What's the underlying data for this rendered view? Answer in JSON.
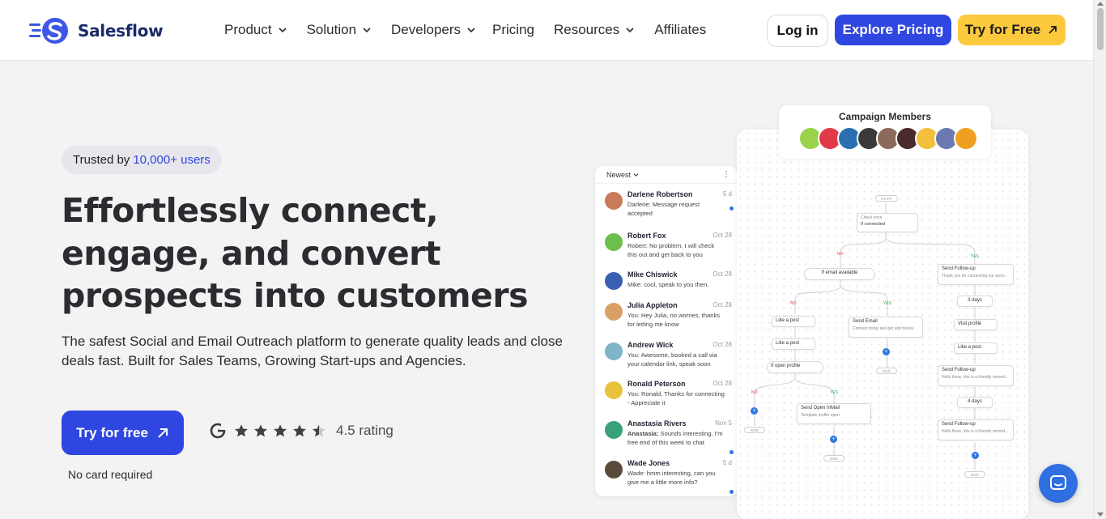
{
  "header": {
    "brand": "Salesflow",
    "nav": [
      {
        "label": "Product",
        "dropdown": true
      },
      {
        "label": "Solution",
        "dropdown": true
      },
      {
        "label": "Developers",
        "dropdown": true
      },
      {
        "label": "Pricing",
        "dropdown": false
      },
      {
        "label": "Resources",
        "dropdown": true
      },
      {
        "label": "Affiliates",
        "dropdown": false
      }
    ],
    "login": "Log in",
    "explore": "Explore Pricing",
    "try": "Try for Free"
  },
  "hero": {
    "trusted_prefix": "Trusted by",
    "trusted_highlight": "10,000+ users",
    "title": "Effortlessly connect, engage, and convert prospects into customers",
    "subtitle": "The safest Social and Email Outreach platform to generate quality leads  and close deals fast. Built for Sales Teams, Growing Start-ups and Agencies.",
    "cta": "Try for free",
    "rating_text": "4.5 rating",
    "rating_value": 4.5,
    "no_card": "No card required"
  },
  "inbox": {
    "sort_label": "Newest",
    "rows": [
      {
        "name": "Darlene Robertson",
        "date": "5 d",
        "prefix": "Darlene",
        "msg": "Darlene: Message request accepted",
        "unread": true,
        "color": "#c97b5a"
      },
      {
        "name": "Robert Fox",
        "date": "Oct 28",
        "msg": "Robert: No problem, I will check this out and get back to you",
        "unread": false,
        "color": "#6bbf4a"
      },
      {
        "name": "Mike Chiswick",
        "date": "Oct 28",
        "msg": "Mike: cool, speak to you then.",
        "unread": false,
        "color": "#3a5fb0"
      },
      {
        "name": "Julia Appleton",
        "date": "Oct 28",
        "msg": "You: Hey Julia, no worries, thanks for letting me know",
        "unread": false,
        "color": "#d9a066"
      },
      {
        "name": "Andrew Wick",
        "date": "Oct 28",
        "msg": "You: Awesome, booked a call via your calendar link, speak soon",
        "unread": false,
        "color": "#7fb5c9"
      },
      {
        "name": "Ronald Peterson",
        "date": "Oct 28",
        "msg": "You: Ronald, Thanks for connecting - Appreciate it",
        "unread": false,
        "color": "#e8c23a"
      },
      {
        "name": "Anastasia Rivers",
        "date": "Nov 5",
        "msg": "Anastasia: Sounds interesting, I'm free end of this week to chat",
        "unread": true,
        "color": "#3aa07a"
      },
      {
        "name": "Wade Jones",
        "date": "5 d",
        "msg": "Wade: hmm interesting, can you give me a little more info?",
        "unread": true,
        "color": "#5a4a3a"
      }
    ]
  },
  "campaign": {
    "title": "Campaign Members",
    "avatar_colors": [
      "#9ad34a",
      "#e03a4a",
      "#2a6fb0",
      "#3a3a3a",
      "#8a6a5a",
      "#4a2a2a",
      "#f2c03a",
      "#6a7ab0",
      "#f0a020"
    ]
  },
  "flow": {
    "start": "START",
    "check_once": "Check once",
    "if_connected": "If connected",
    "no": "NO",
    "yes": "YES",
    "if_email_available": "If email available",
    "send_followup": "Send Follow-up",
    "followup_sub": "Thank you for connecting our servi...",
    "like_post": "Like a post",
    "send_email": "Send Email",
    "send_email_sub": "Connect today and get and bonus...",
    "three_days": "3 days",
    "visit_profile": "Visit profile",
    "if_open_profile": "If open profile",
    "followup_sub2": "Hello there, this is a friendly remind...",
    "four_days": "4 days",
    "send_open_inmail": "Send Open InMail",
    "inmail_sub": "Template profile open",
    "end": "END"
  }
}
